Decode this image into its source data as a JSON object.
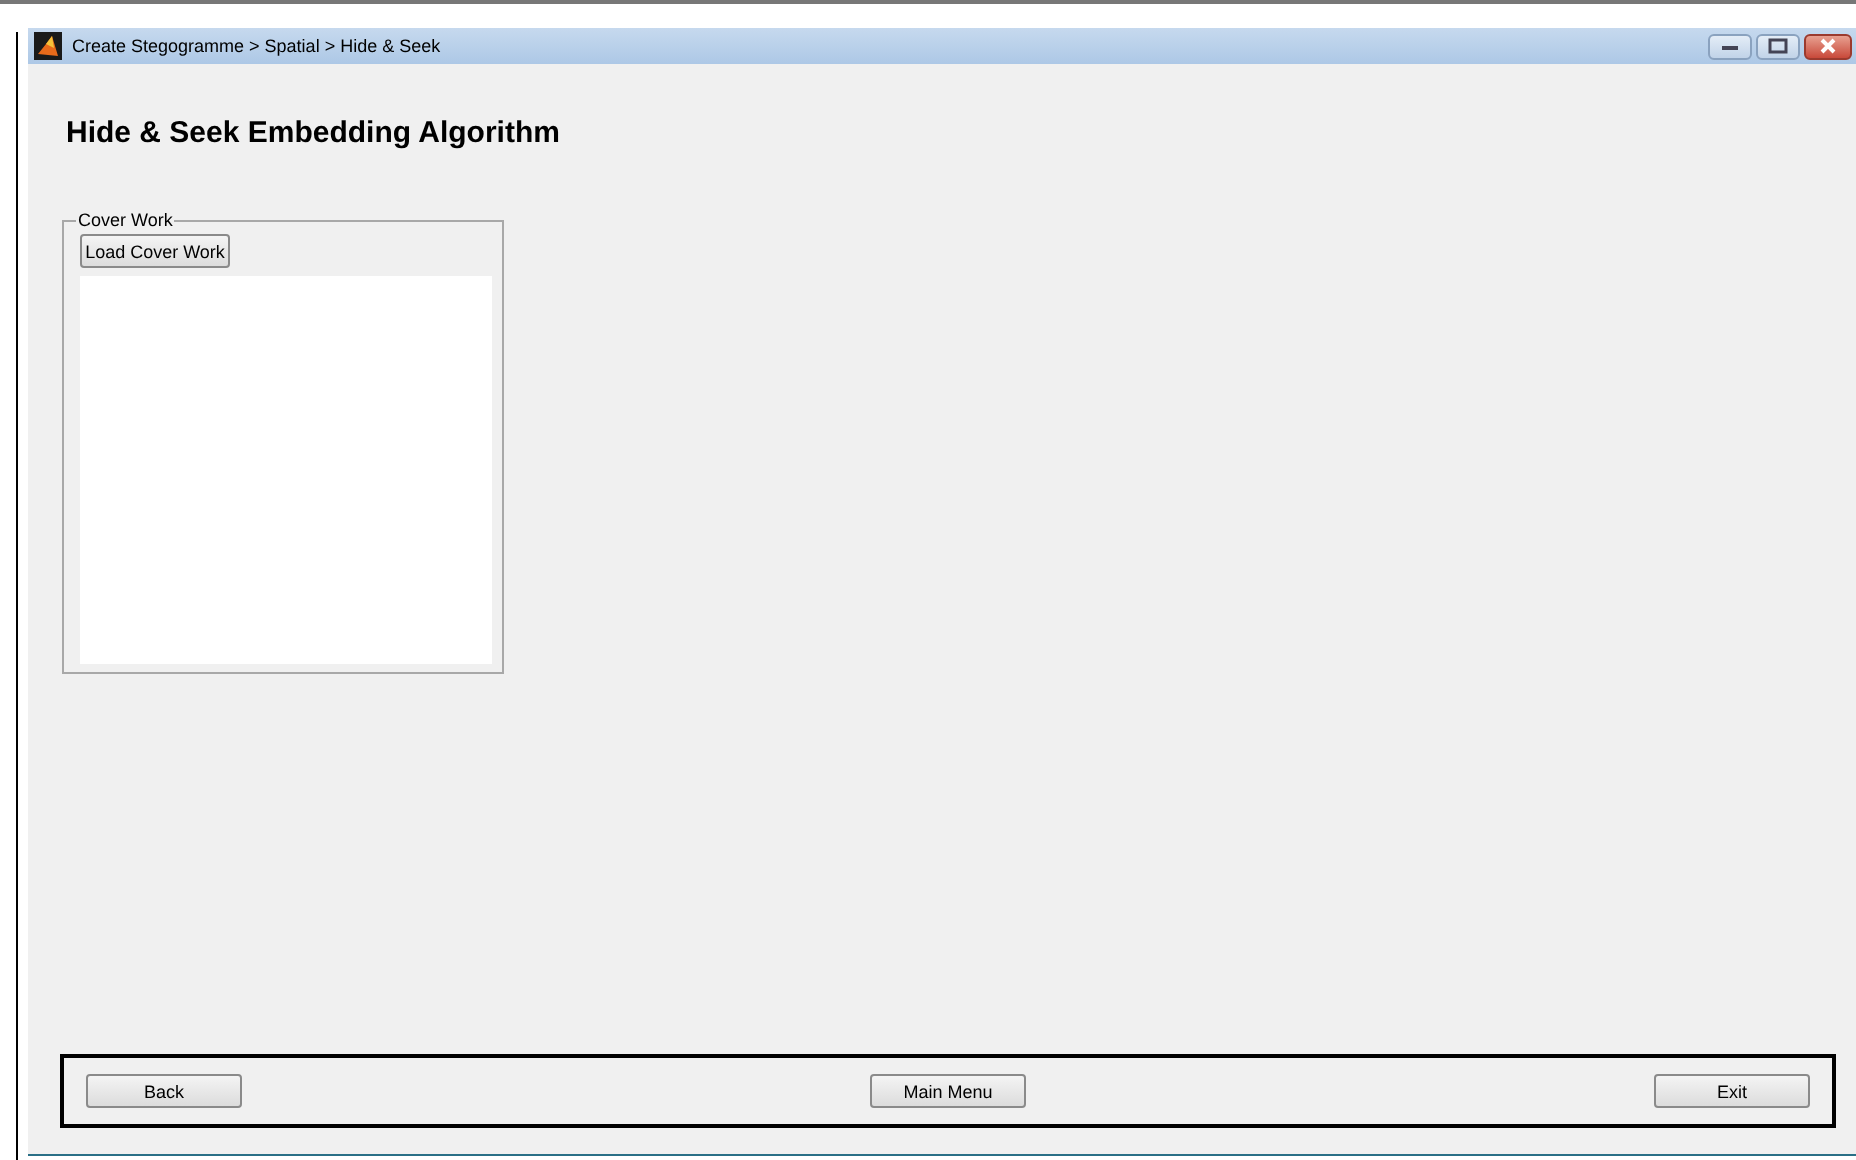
{
  "window": {
    "title": "Create Stegogramme > Spatial > Hide & Seek"
  },
  "heading": "Hide & Seek Embedding Algorithm",
  "cover_panel": {
    "title": "Cover Work",
    "button": "Load Cover Work"
  },
  "footer_buttons": [
    {
      "label": "Back"
    },
    {
      "label": "Main Menu"
    },
    {
      "label": "Exit"
    }
  ]
}
